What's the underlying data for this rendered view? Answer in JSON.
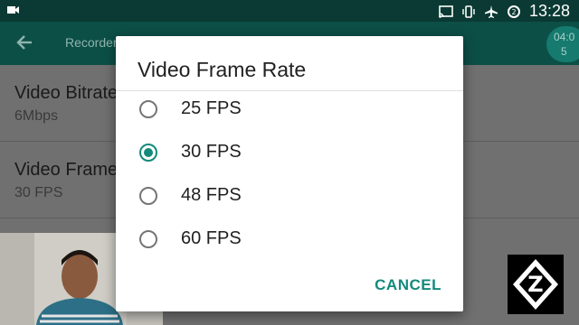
{
  "status_bar": {
    "time": "13:28",
    "icons": [
      "videocam-icon",
      "cast-icon",
      "vibrate-icon",
      "airplane-mode-icon",
      "data-saver-icon"
    ]
  },
  "app_bar": {
    "back_icon": "arrow-back-icon",
    "title": "Recorder",
    "timer_line1": "04:0",
    "timer_line2": "5"
  },
  "settings": [
    {
      "title": "Video Bitrate",
      "summary": "6Mbps"
    },
    {
      "title": "Video Frame",
      "summary": "30 FPS"
    }
  ],
  "dialog": {
    "title": "Video Frame Rate",
    "options": [
      {
        "label": "25 FPS",
        "selected": false
      },
      {
        "label": "30 FPS",
        "selected": true
      },
      {
        "label": "48 FPS",
        "selected": false
      },
      {
        "label": "60 FPS",
        "selected": false
      }
    ],
    "cancel_label": "CANCEL"
  },
  "overlays": {
    "webcam": "presenter-webcam",
    "logo_letter": "Z"
  },
  "colors": {
    "accent": "#138a7c",
    "app_bar": "#0c4f47",
    "status_bar": "#0a3a33"
  }
}
